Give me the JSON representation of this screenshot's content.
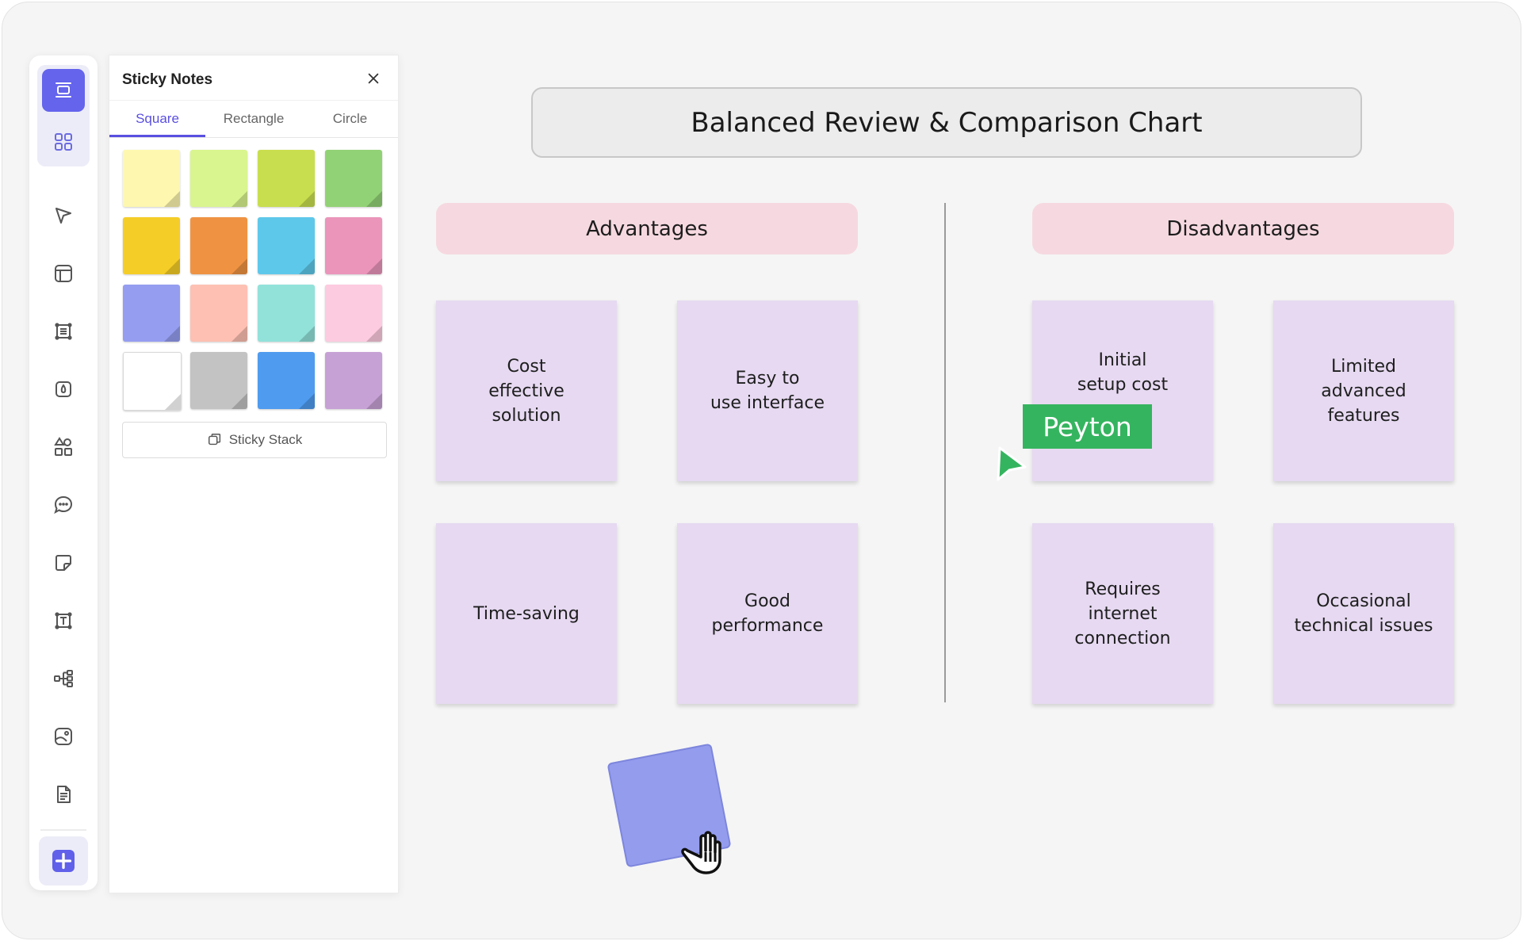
{
  "toolbar": {
    "items": [
      {
        "name": "templates-icon",
        "active": true
      },
      {
        "name": "apps-grid-icon"
      },
      {
        "name": "select-pointer-icon"
      },
      {
        "name": "layout-icon"
      },
      {
        "name": "frame-icon"
      },
      {
        "name": "pen-icon"
      },
      {
        "name": "shapes-icon"
      },
      {
        "name": "comment-icon"
      },
      {
        "name": "sticky-note-icon"
      },
      {
        "name": "text-icon"
      },
      {
        "name": "mindmap-icon"
      },
      {
        "name": "image-icon"
      },
      {
        "name": "document-icon"
      }
    ],
    "add_icon": "plus-icon"
  },
  "sticky_panel": {
    "title": "Sticky Notes",
    "close_icon": "close-icon",
    "tabs": [
      {
        "label": "Square",
        "active": true
      },
      {
        "label": "Rectangle"
      },
      {
        "label": "Circle"
      }
    ],
    "swatches": [
      "#fef7b0",
      "#d9f58f",
      "#c9de4e",
      "#92d276",
      "#f5cd27",
      "#ef9343",
      "#5ec8ea",
      "#eb95bb",
      "#959df0",
      "#fdc0b3",
      "#92e2da",
      "#fdcbdf",
      "#ffffff",
      "#c3c3c3",
      "#4f9bef",
      "#c6a1d5"
    ],
    "stack_button_label": "Sticky Stack",
    "stack_icon": "sticky-stack-icon"
  },
  "board": {
    "title": "Balanced Review & Comparison Chart",
    "advantages_header": "Advantages",
    "disadvantages_header": "Disadvantages",
    "advantages": [
      "Cost\neffective\nsolution",
      "Easy to\nuse interface",
      "Time-saving",
      "Good\nperformance"
    ],
    "disadvantages": [
      "Initial\nsetup cost",
      "Limited\nadvanced\nfeatures",
      "Requires\ninternet\nconnection",
      "Occasional\ntechnical issues"
    ],
    "collaborator_name": "Peyton",
    "collaborator_color": "#35b45f",
    "note_color": "#e6d9f1",
    "header_color": "#f6d9e0",
    "dragging_note_color": "#949cee"
  }
}
